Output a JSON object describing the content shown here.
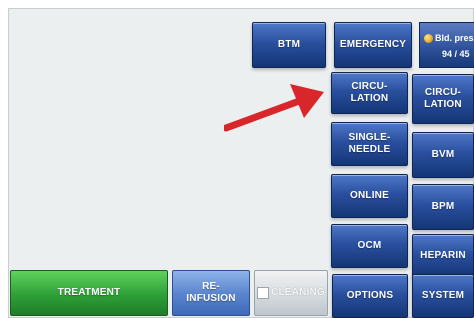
{
  "top_buttons": {
    "btm": "BTM",
    "emergency": "EMERGENCY"
  },
  "blood_pressure": {
    "label": "Bld. pres",
    "value": "94 / 45",
    "indicator_color": "#e3a61a"
  },
  "middle_column": [
    {
      "line1": "CIRCU-",
      "line2": "LATION"
    },
    {
      "line1": "SINGLE-",
      "line2": "NEEDLE"
    },
    {
      "line1": "ONLINE",
      "line2": ""
    },
    {
      "line1": "OCM",
      "line2": ""
    }
  ],
  "right_column": [
    {
      "line1": "CIRCU-",
      "line2": "LATION"
    },
    {
      "line1": "BVM",
      "line2": ""
    },
    {
      "line1": "BPM",
      "line2": ""
    },
    {
      "line1": "HEPARIN",
      "line2": ""
    }
  ],
  "bottom_bar": {
    "treatment": "TREATMENT",
    "reinfusion_line1": "RE-",
    "reinfusion_line2": "INFUSION",
    "cleaning": "CLEANING",
    "options": "OPTIONS",
    "system": "SYSTEM"
  },
  "annotation": {
    "arrow_color": "#d8262a"
  }
}
